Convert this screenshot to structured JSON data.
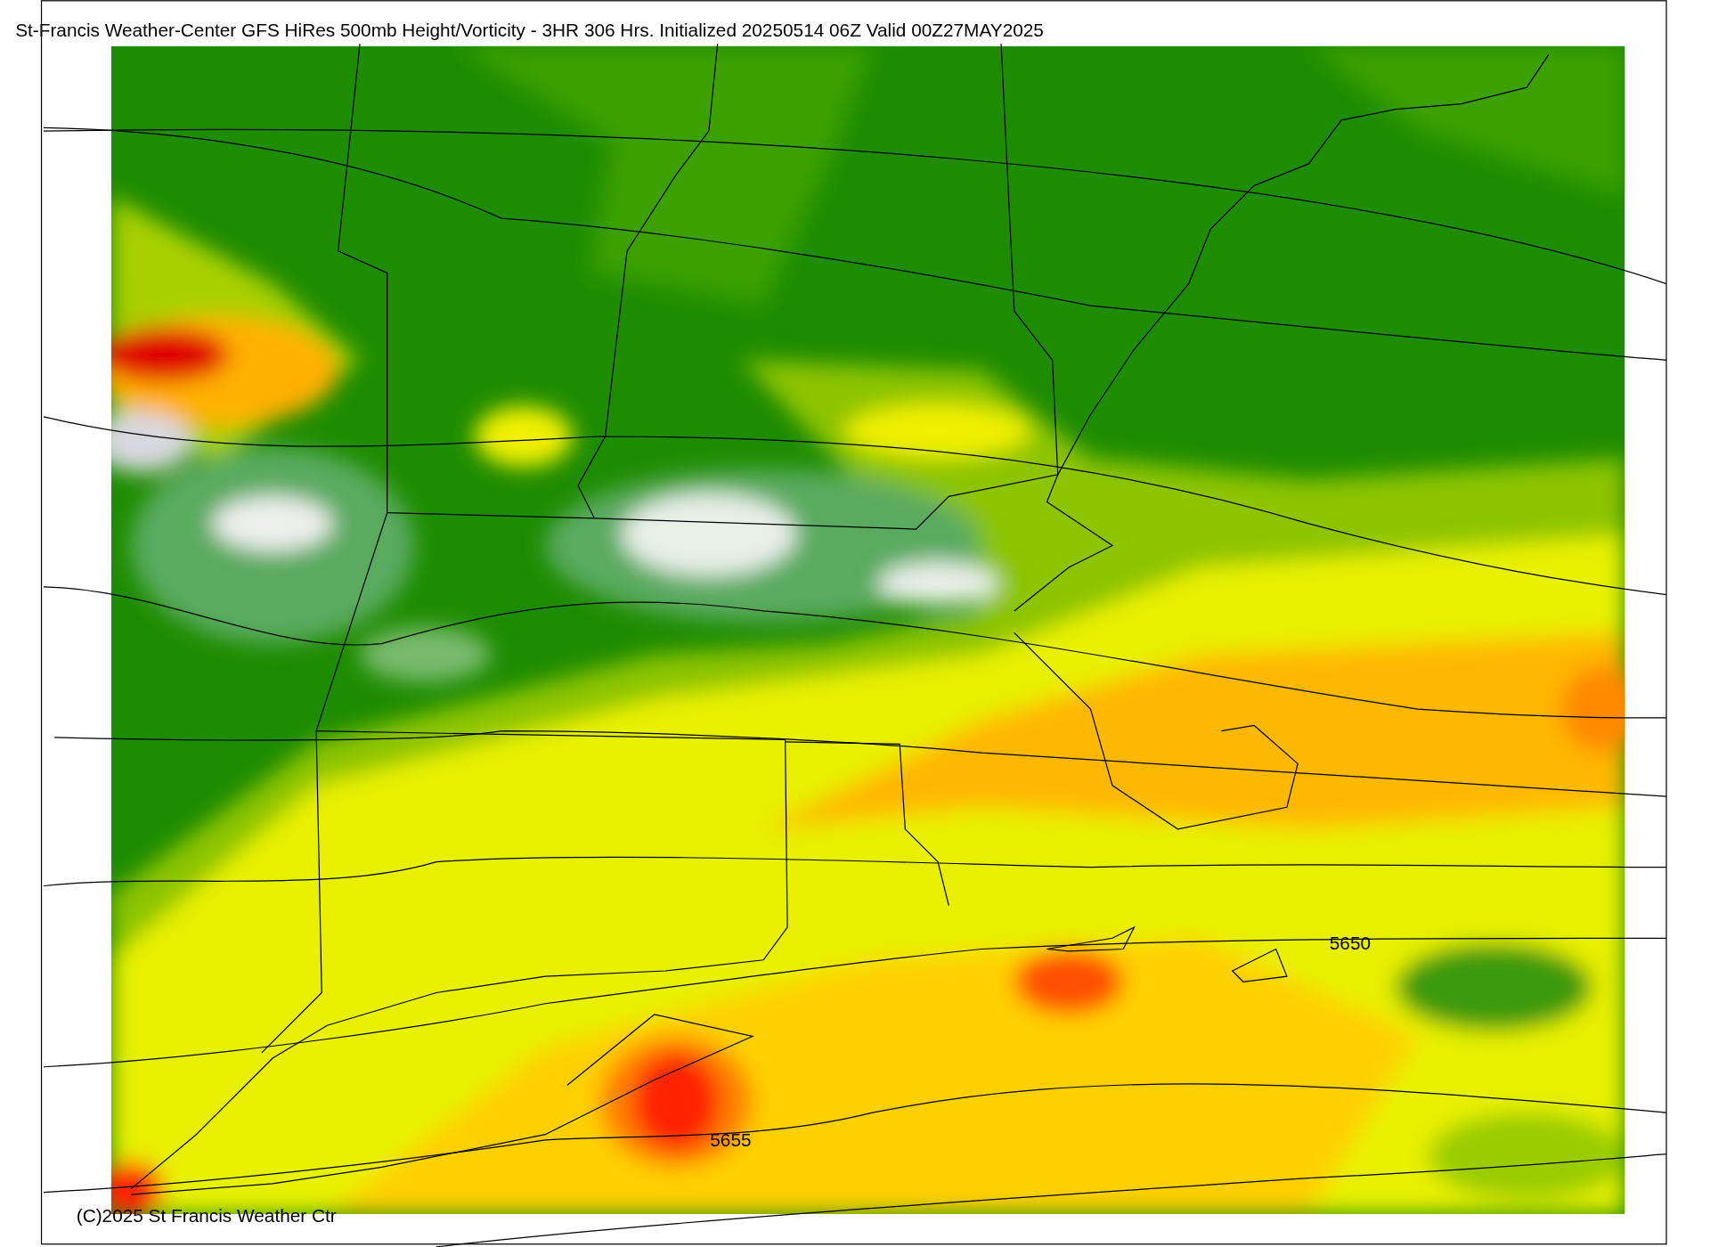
{
  "title": "St-Francis Weather-Center GFS HiRes 500mb Height/Vorticity - 3HR  306 Hrs.  Initialized 20250514 06Z Valid 00Z27MAY2025",
  "copyright": "(C)2025 St Francis Weather Ctr",
  "contour_labels": [
    "5650",
    "5655"
  ]
}
